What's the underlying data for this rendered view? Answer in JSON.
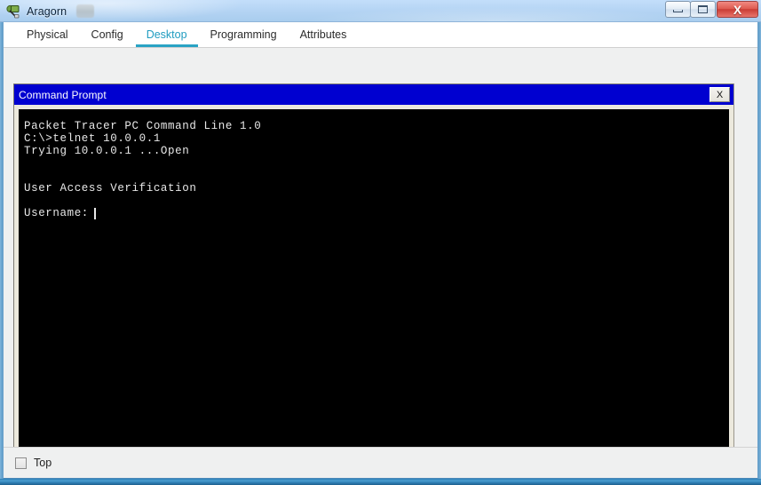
{
  "window": {
    "title": "Aragorn",
    "app_icon_name": "packet-tracer-device-icon",
    "controls": {
      "minimize_label": "—",
      "maximize_label": "□",
      "close_label": "X"
    }
  },
  "tabs": [
    {
      "label": "Physical",
      "active": false
    },
    {
      "label": "Config",
      "active": false
    },
    {
      "label": "Desktop",
      "active": true
    },
    {
      "label": "Programming",
      "active": false
    },
    {
      "label": "Attributes",
      "active": false
    }
  ],
  "command_prompt": {
    "title": "Command Prompt",
    "close_label": "X",
    "lines": [
      "Packet Tracer PC Command Line 1.0",
      "C:\\>telnet 10.0.0.1",
      "Trying 10.0.0.1 ...Open",
      "",
      "",
      "User Access Verification",
      "",
      "Username:"
    ],
    "prompt_text": "Username:",
    "cursor_visible": true
  },
  "footer": {
    "top_checkbox_label": "Top",
    "top_checkbox_checked": false
  },
  "colors": {
    "accent_tab": "#29a3c4",
    "cmd_titlebar": "#0000d0",
    "terminal_bg": "#000000",
    "terminal_fg": "#e8e8e8",
    "panel_bg": "#eff0f0"
  }
}
